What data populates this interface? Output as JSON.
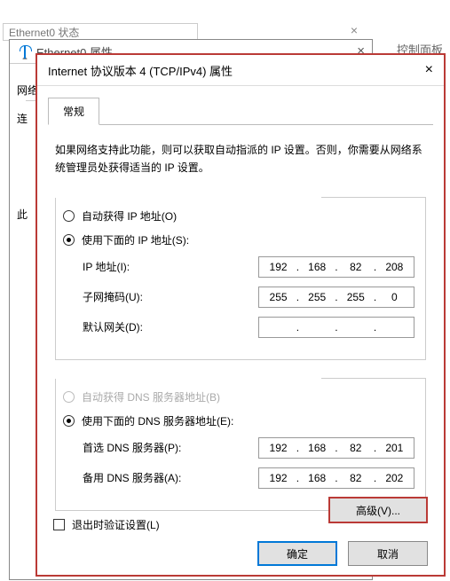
{
  "bg": {
    "win1_title": "Ethernet0 状态",
    "win2_title": "Ethernet0 属性",
    "right_title": "控制面板",
    "net_label": "网络",
    "connect_label": "连",
    "this_label": "此"
  },
  "dialog": {
    "title": "Internet 协议版本 4 (TCP/IPv4) 属性",
    "tab_general": "常规",
    "description": "如果网络支持此功能，则可以获取自动指派的 IP 设置。否则，你需要从网络系统管理员处获得适当的 IP 设置。"
  },
  "ip_section": {
    "auto_ip": "自动获得 IP 地址(O)",
    "use_ip": "使用下面的 IP 地址(S):",
    "ip_label": "IP 地址(I):",
    "mask_label": "子网掩码(U):",
    "gw_label": "默认网关(D):",
    "ip": [
      "192",
      "168",
      "82",
      "208"
    ],
    "mask": [
      "255",
      "255",
      "255",
      "0"
    ],
    "gw": [
      "",
      "",
      "",
      ""
    ]
  },
  "dns_section": {
    "auto_dns": "自动获得 DNS 服务器地址(B)",
    "use_dns": "使用下面的 DNS 服务器地址(E):",
    "pref_label": "首选 DNS 服务器(P):",
    "alt_label": "备用 DNS 服务器(A):",
    "pref": [
      "192",
      "168",
      "82",
      "201"
    ],
    "alt": [
      "192",
      "168",
      "82",
      "202"
    ]
  },
  "footer": {
    "validate": "退出时验证设置(L)",
    "advanced": "高级(V)...",
    "ok": "确定",
    "cancel": "取消"
  }
}
